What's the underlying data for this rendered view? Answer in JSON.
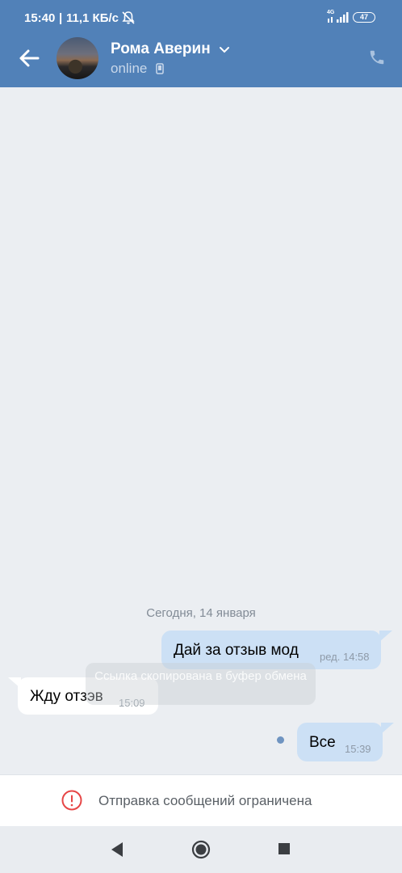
{
  "status_bar": {
    "time": "15:40",
    "separator": "|",
    "speed": "11,1 КБ/с",
    "network": "4G",
    "battery": "47"
  },
  "header": {
    "name": "Рома Аверин",
    "presence": "online"
  },
  "chat": {
    "date_separator": "Сегодня, 14 января",
    "messages": [
      {
        "direction": "out",
        "text": "Дай за отзыв мод",
        "time": "ред. 14:58"
      },
      {
        "direction": "in",
        "text": "Жду отзэв",
        "time": "15:09"
      },
      {
        "direction": "out",
        "text": "Все",
        "time": "15:39",
        "unread": true
      }
    ],
    "toast": "Ссылка скопирована в буфер обмена"
  },
  "composer": {
    "restricted_text": "Отправка сообщений ограничена"
  },
  "colors": {
    "header": "#5181b8",
    "background": "#ebeef2",
    "outgoing_bubble": "#cce0f5",
    "incoming_bubble": "#ffffff",
    "warning": "#e64646"
  }
}
